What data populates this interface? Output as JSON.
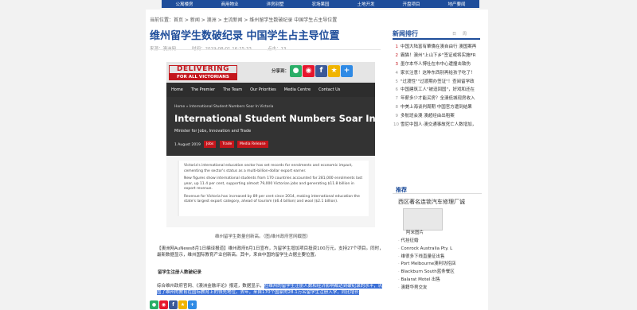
{
  "nav": [
    "公寓楼房",
    "商用物业",
    "洋房别墅",
    "农场果园",
    "土地开发",
    "开盘项目",
    "地产要闻"
  ],
  "breadcrumb": "当前位置：首页 > 新闻 > 澳洲 > 主流新闻 > 维州留学生数破纪录 中国学生占主导位置",
  "article": {
    "title": "维州留学生数破纪录 中国学生占主导位置",
    "source": "来源：澳洲网",
    "time": "时间：2019-08-01 16:25:33",
    "views": "点击：13",
    "caption": "维州留学生数量创新高。（图/维州政府官网截图）",
    "para1": "【澳洲网AuNews8月1日编译报道】维州政府8月1日宣布，为留学生增加项目投资100万元，支持27个项目。同时，最新数据显示，维州国际教育产业创新高。其中，来自中国的留学生占据主要位置。",
    "para_heading": "留学生注册人数破纪录",
    "para2_pre": "综合维州政府官网、《澳洲金融评论》报道，数据显示，",
    "para2_hl": "在维州的留学生注册人数和经济影响都达到破纪录的水平，巩固了维州的教育在国际教育上的领先地位。去年，来自170个国家的28.1万名留学生注册入学，同比增长"
  },
  "banner": {
    "logo_top": "DELIVERING",
    "logo_bottom": "FOR ALL VICTORIANS",
    "share_label": "分享到：",
    "menu": [
      "Home",
      "The Premier",
      "The Team",
      "Our Priorities",
      "Media Centre",
      "Contact Us"
    ],
    "crumb": "Home » International Student Numbers Soar In Victoria",
    "headline": "International Student Numbers Soar In Victoria",
    "minister": "Minister for Jobs, Innovation and Trade",
    "date": "1 August 2019",
    "tags": [
      "Jobs",
      "Trade",
      "Media Release"
    ],
    "p1": "Victoria's international education sector has set records for enrolments and economic impact, cementing the sector's status as a multi-billion-dollar export earner.",
    "p2": "New figures show international students from 170 countries accounted for 281,000 enrolments last year, up 11.4 per cent, supporting almost 79,000 Victorian jobs and generating $11.8 billion in export revenue.",
    "p3": "Revenue for Victoria has increased by 89 per cent since 2014, making international education the state's largest export category, ahead of tourism ($6.4 billion) and wool ($2.1 billion)."
  },
  "sidebar": {
    "section_title": "新闻排行",
    "tabs": [
      "日",
      "周"
    ],
    "rank": [
      {
        "n": "1",
        "t": "中国大陆富有華僑在澳自由行 澳国案再"
      },
      {
        "n": "2",
        "t": "霸猫！澳州\"上山下乡\"签证或将实施FR"
      },
      {
        "n": "3",
        "t": "墨尔本华人博社在市中心遭撞击致伤"
      },
      {
        "n": "4",
        "t": "家长注意！这种东西别再给孩子吃了！"
      },
      {
        "n": "5",
        "t": "\"过渡性\"\"过渡期办签证\"！查阅留学政"
      },
      {
        "n": "6",
        "t": "中国建筑工人\"被迫回国\"，好戏和还在"
      },
      {
        "n": "7",
        "t": "年薪多少才能买房？全澳低城现房收入"
      },
      {
        "n": "8",
        "t": "中美上海谈判周期 中国官方遭到结果"
      },
      {
        "n": "9",
        "t": "多航班会澳 澳超经由出租案"
      },
      {
        "n": "10",
        "t": "雪尼中国人·澳交通事故死亡人数增加，"
      }
    ],
    "tj_title": "推荐",
    "tj_sub": "西区著名连锁汽车修理厂诚",
    "logo_caption": "阿米图片",
    "tj_list": [
      "代挂征婚",
      "Conrock Australia Pty. L",
      "维很多下线直量征出售",
      "Port Melbourne澳利坊招店",
      "Blackburn South蓝条餐区",
      "Balarat Motel 出售",
      "澳籍华男交友"
    ]
  },
  "colors": {
    "brand": "#1e4d9a",
    "accent": "#c4161c",
    "highlight": "#3b6fd6"
  }
}
